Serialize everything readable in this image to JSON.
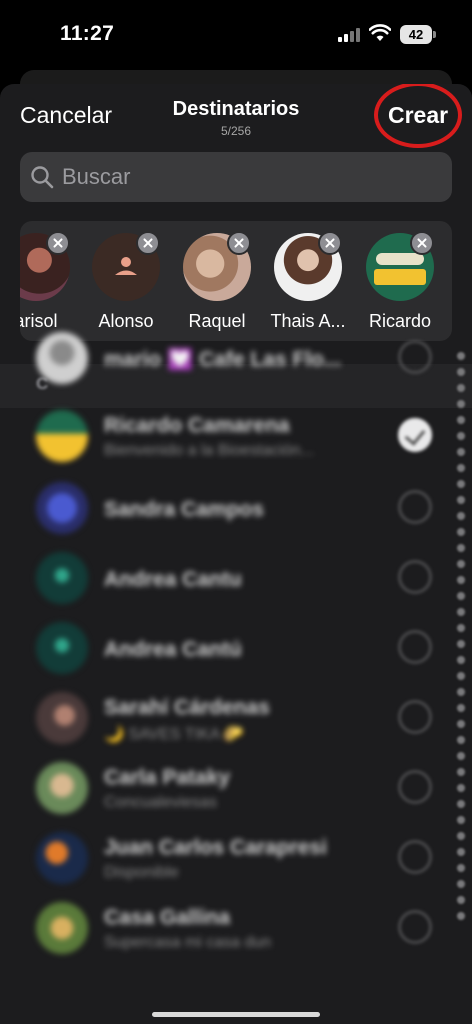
{
  "status_bar": {
    "time": "11:27",
    "battery": "42"
  },
  "nav": {
    "cancel_label": "Cancelar",
    "title": "Destinatarios",
    "count": "5/256",
    "create_label": "Crear"
  },
  "search": {
    "placeholder": "Buscar"
  },
  "selected": [
    {
      "name": "arisol",
      "avatar": "photo"
    },
    {
      "name": "Alonso",
      "avatar": "person-placeholder"
    },
    {
      "name": "Raquel",
      "avatar": "photo"
    },
    {
      "name": "Thais A...",
      "avatar": "photo"
    },
    {
      "name": "Ricardo",
      "avatar": "logo"
    }
  ],
  "section_letter": "C",
  "contacts": [
    {
      "name": "mario 💟 Cafe Las Flo...",
      "subtitle": "",
      "checked": false
    },
    {
      "name": "Ricardo Camarena",
      "subtitle": "Bienvenido a la Bioestación...",
      "checked": true
    },
    {
      "name": "Sandra Campos",
      "subtitle": "",
      "checked": false
    },
    {
      "name": "Andrea Cantu",
      "subtitle": "",
      "checked": false
    },
    {
      "name": "Andrea Cantú",
      "subtitle": "",
      "checked": false
    },
    {
      "name": "Sarahí Cárdenas",
      "subtitle": "🌙 SAVES TIKA 🌮",
      "checked": false
    },
    {
      "name": "Carla Pataky",
      "subtitle": "Concualeviesas",
      "checked": false
    },
    {
      "name": "Juan Carlos Carapresi",
      "subtitle": "Disponible",
      "checked": false
    },
    {
      "name": "Casa Gallina",
      "subtitle": "Supercasa mi casa dun",
      "checked": false
    }
  ],
  "colors": {
    "accent_ring": "#d81c1c",
    "background": "#000000",
    "sheet": "#1c1c1e"
  },
  "icons": {
    "search": "magnifier-icon",
    "remove": "close-circle-icon",
    "check": "checkmark-circle-icon"
  }
}
